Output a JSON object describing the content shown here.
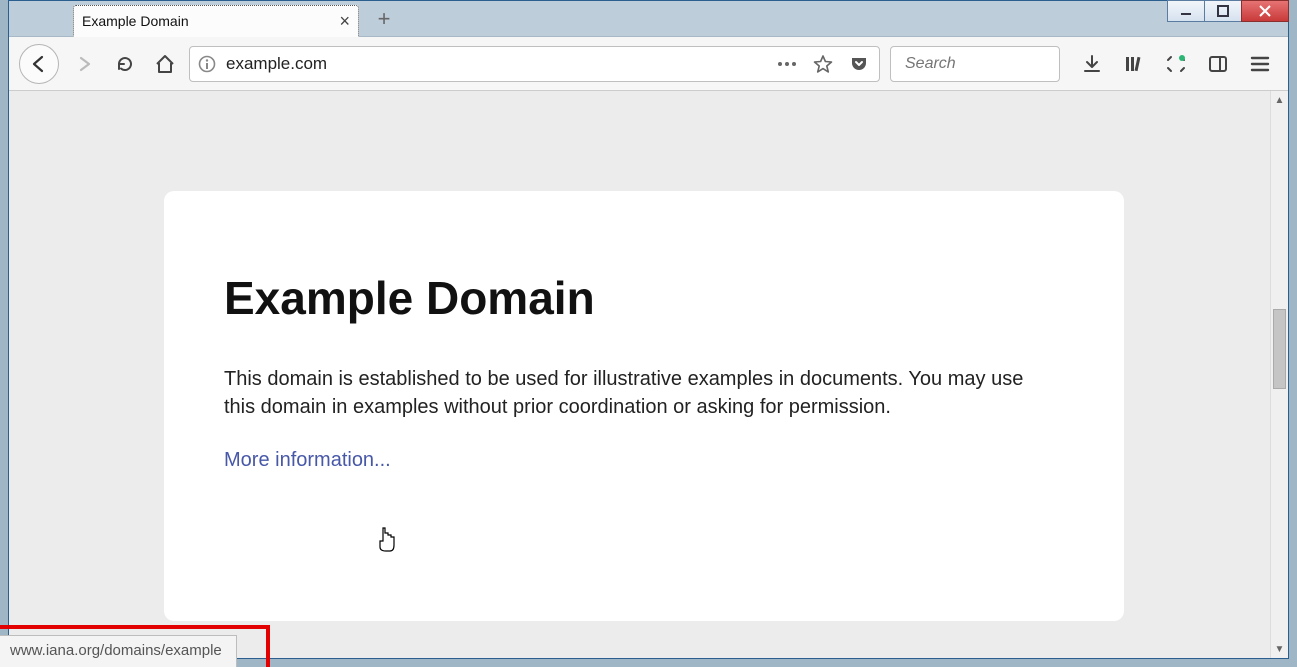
{
  "tab": {
    "title": "Example Domain"
  },
  "url": {
    "value": "example.com"
  },
  "search": {
    "placeholder": "Search"
  },
  "page": {
    "heading": "Example Domain",
    "paragraph": "This domain is established to be used for illustrative examples in documents. You may use this domain in examples without prior coordination or asking for permission.",
    "link_text": "More information..."
  },
  "status": {
    "hover_url": "www.iana.org/domains/example"
  }
}
